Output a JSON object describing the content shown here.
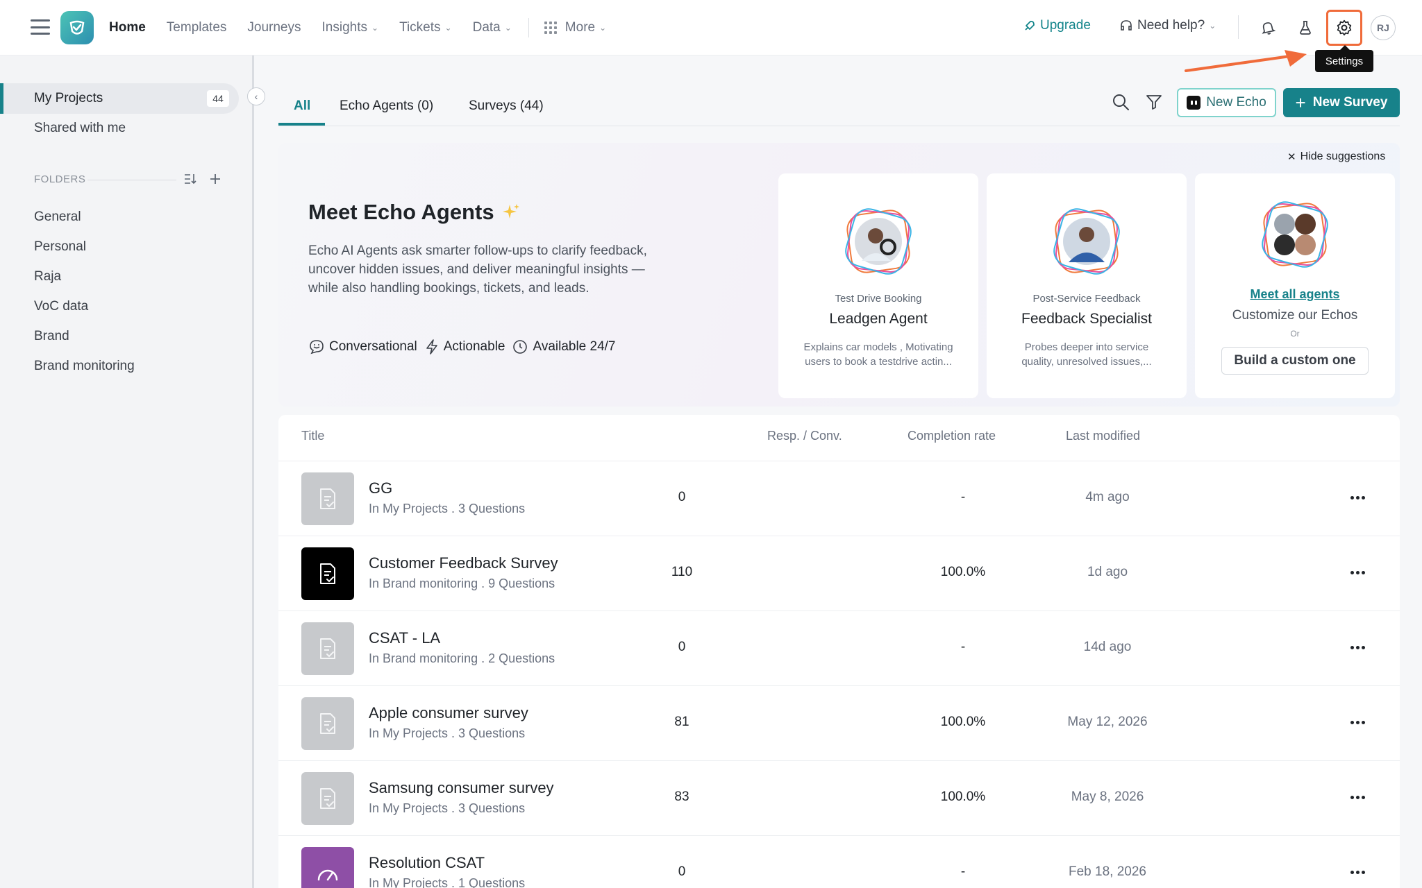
{
  "topbar": {
    "nav": [
      {
        "label": "Home",
        "active": true,
        "dropdown": false
      },
      {
        "label": "Templates",
        "active": false,
        "dropdown": false
      },
      {
        "label": "Journeys",
        "active": false,
        "dropdown": false
      },
      {
        "label": "Insights",
        "active": false,
        "dropdown": true
      },
      {
        "label": "Tickets",
        "active": false,
        "dropdown": true
      },
      {
        "label": "Data",
        "active": false,
        "dropdown": true
      },
      {
        "label": "More",
        "active": false,
        "dropdown": true
      }
    ],
    "upgrade_label": "Upgrade",
    "help_label": "Need help?",
    "avatar_initials": "RJ",
    "settings_tooltip": "Settings"
  },
  "sidebar": {
    "my_projects": "My Projects",
    "my_projects_count": "44",
    "shared": "Shared with me",
    "folders_label": "FOLDERS",
    "folders": [
      "General",
      "Personal",
      "Raja",
      "VoC data",
      "Brand",
      "Brand monitoring"
    ]
  },
  "tabs": [
    {
      "label": "All",
      "active": true
    },
    {
      "label": "Echo Agents (0)",
      "active": false
    },
    {
      "label": "Surveys (44)",
      "active": false
    }
  ],
  "actions": {
    "new_echo": "New Echo",
    "new_survey": "New Survey"
  },
  "hero": {
    "hide_label": "Hide suggestions",
    "title": "Meet Echo Agents",
    "description": "Echo AI Agents ask smarter follow-ups to clarify feedback, uncover hidden issues, and deliver meaningful insights — while also handling bookings, tickets, and leads.",
    "features": [
      "Conversational",
      "Actionable",
      "Available 24/7"
    ],
    "agents": [
      {
        "subtitle": "Test Drive Booking",
        "name": "Leadgen Agent",
        "desc1": "Explains car models , Motivating",
        "desc2": "users to book a testdrive actin..."
      },
      {
        "subtitle": "Post-Service Feedback",
        "name": "Feedback Specialist",
        "desc1": "Probes deeper into service",
        "desc2": "quality, unresolved issues,..."
      }
    ],
    "meet_all": "Meet all agents",
    "customize": "Customize our Echos",
    "or": "Or",
    "build_custom": "Build a custom one"
  },
  "table": {
    "headers": {
      "title": "Title",
      "resp": "Resp. / Conv.",
      "completion": "Completion rate",
      "modified": "Last modified"
    },
    "rows": [
      {
        "title": "GG",
        "sub": "In My Projects . 3 Questions",
        "resp": "0",
        "completion": "-",
        "modified": "4m ago",
        "thumb": "survey-gray"
      },
      {
        "title": "Customer Feedback Survey",
        "sub": "In Brand monitoring . 9 Questions",
        "resp": "110",
        "completion": "100.0%",
        "modified": "1d ago",
        "thumb": "survey-black"
      },
      {
        "title": "CSAT - LA",
        "sub": "In Brand monitoring . 2 Questions",
        "resp": "0",
        "completion": "-",
        "modified": "14d ago",
        "thumb": "survey-gray"
      },
      {
        "title": "Apple consumer survey",
        "sub": "In My Projects . 3 Questions",
        "resp": "81",
        "completion": "100.0%",
        "modified": "May 12, 2026",
        "thumb": "survey-gray"
      },
      {
        "title": "Samsung consumer survey",
        "sub": "In My Projects . 3 Questions",
        "resp": "83",
        "completion": "100.0%",
        "modified": "May 8, 2026",
        "thumb": "survey-gray"
      },
      {
        "title": "Resolution CSAT",
        "sub": "In My Projects . 1 Questions",
        "resp": "0",
        "completion": "-",
        "modified": "Feb 18, 2026",
        "thumb": "gauge-purple"
      }
    ]
  },
  "colors": {
    "accent": "#17828a",
    "highlight": "#f06b3a",
    "purple": "#8e4fa6"
  }
}
